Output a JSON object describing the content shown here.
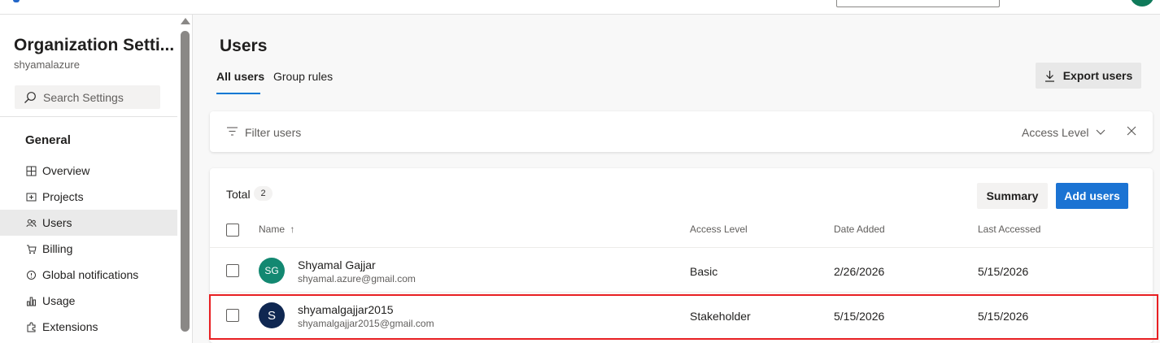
{
  "sidebar": {
    "org_title": "Organization Setti...",
    "org_name": "shyamalazure",
    "search_placeholder": "Search Settings",
    "section": "General",
    "items": [
      {
        "label": "Overview",
        "icon": "overview-icon",
        "selected": false
      },
      {
        "label": "Projects",
        "icon": "projects-icon",
        "selected": false
      },
      {
        "label": "Users",
        "icon": "users-icon",
        "selected": true
      },
      {
        "label": "Billing",
        "icon": "cart-icon",
        "selected": false
      },
      {
        "label": "Global notifications",
        "icon": "notification-icon",
        "selected": false
      },
      {
        "label": "Usage",
        "icon": "usage-chart-icon",
        "selected": false
      },
      {
        "label": "Extensions",
        "icon": "extensions-icon",
        "selected": false
      }
    ]
  },
  "main": {
    "title": "Users",
    "tabs": [
      {
        "label": "All users",
        "active": true
      },
      {
        "label": "Group rules",
        "active": false
      }
    ],
    "export_label": "Export users",
    "filter": {
      "placeholder": "Filter users",
      "access_level_label": "Access Level"
    },
    "table": {
      "total_label": "Total",
      "total_count": "2",
      "summary_label": "Summary",
      "add_users_label": "Add users",
      "columns": {
        "name": "Name",
        "sort_indicator": "↑",
        "access_level": "Access Level",
        "date_added": "Date Added",
        "last_accessed": "Last Accessed"
      },
      "rows": [
        {
          "initials": "SG",
          "avatar_color": "#138871",
          "name": "Shyamal Gajjar",
          "email": "shyamal.azure@gmail.com",
          "access_level": "Basic",
          "date_added": "2/26/2026",
          "last_accessed": "5/15/2026"
        },
        {
          "initials": "S",
          "avatar_color": "#0f2751",
          "name": "shyamalgajjar2015",
          "email": "shyamalgajjar2015@gmail.com",
          "access_level": "Stakeholder",
          "date_added": "5/15/2026",
          "last_accessed": "5/15/2026"
        }
      ]
    }
  },
  "colors": {
    "accent": "#0078d4",
    "primary_button": "#1b73d3",
    "highlight_border": "#e81f22"
  }
}
